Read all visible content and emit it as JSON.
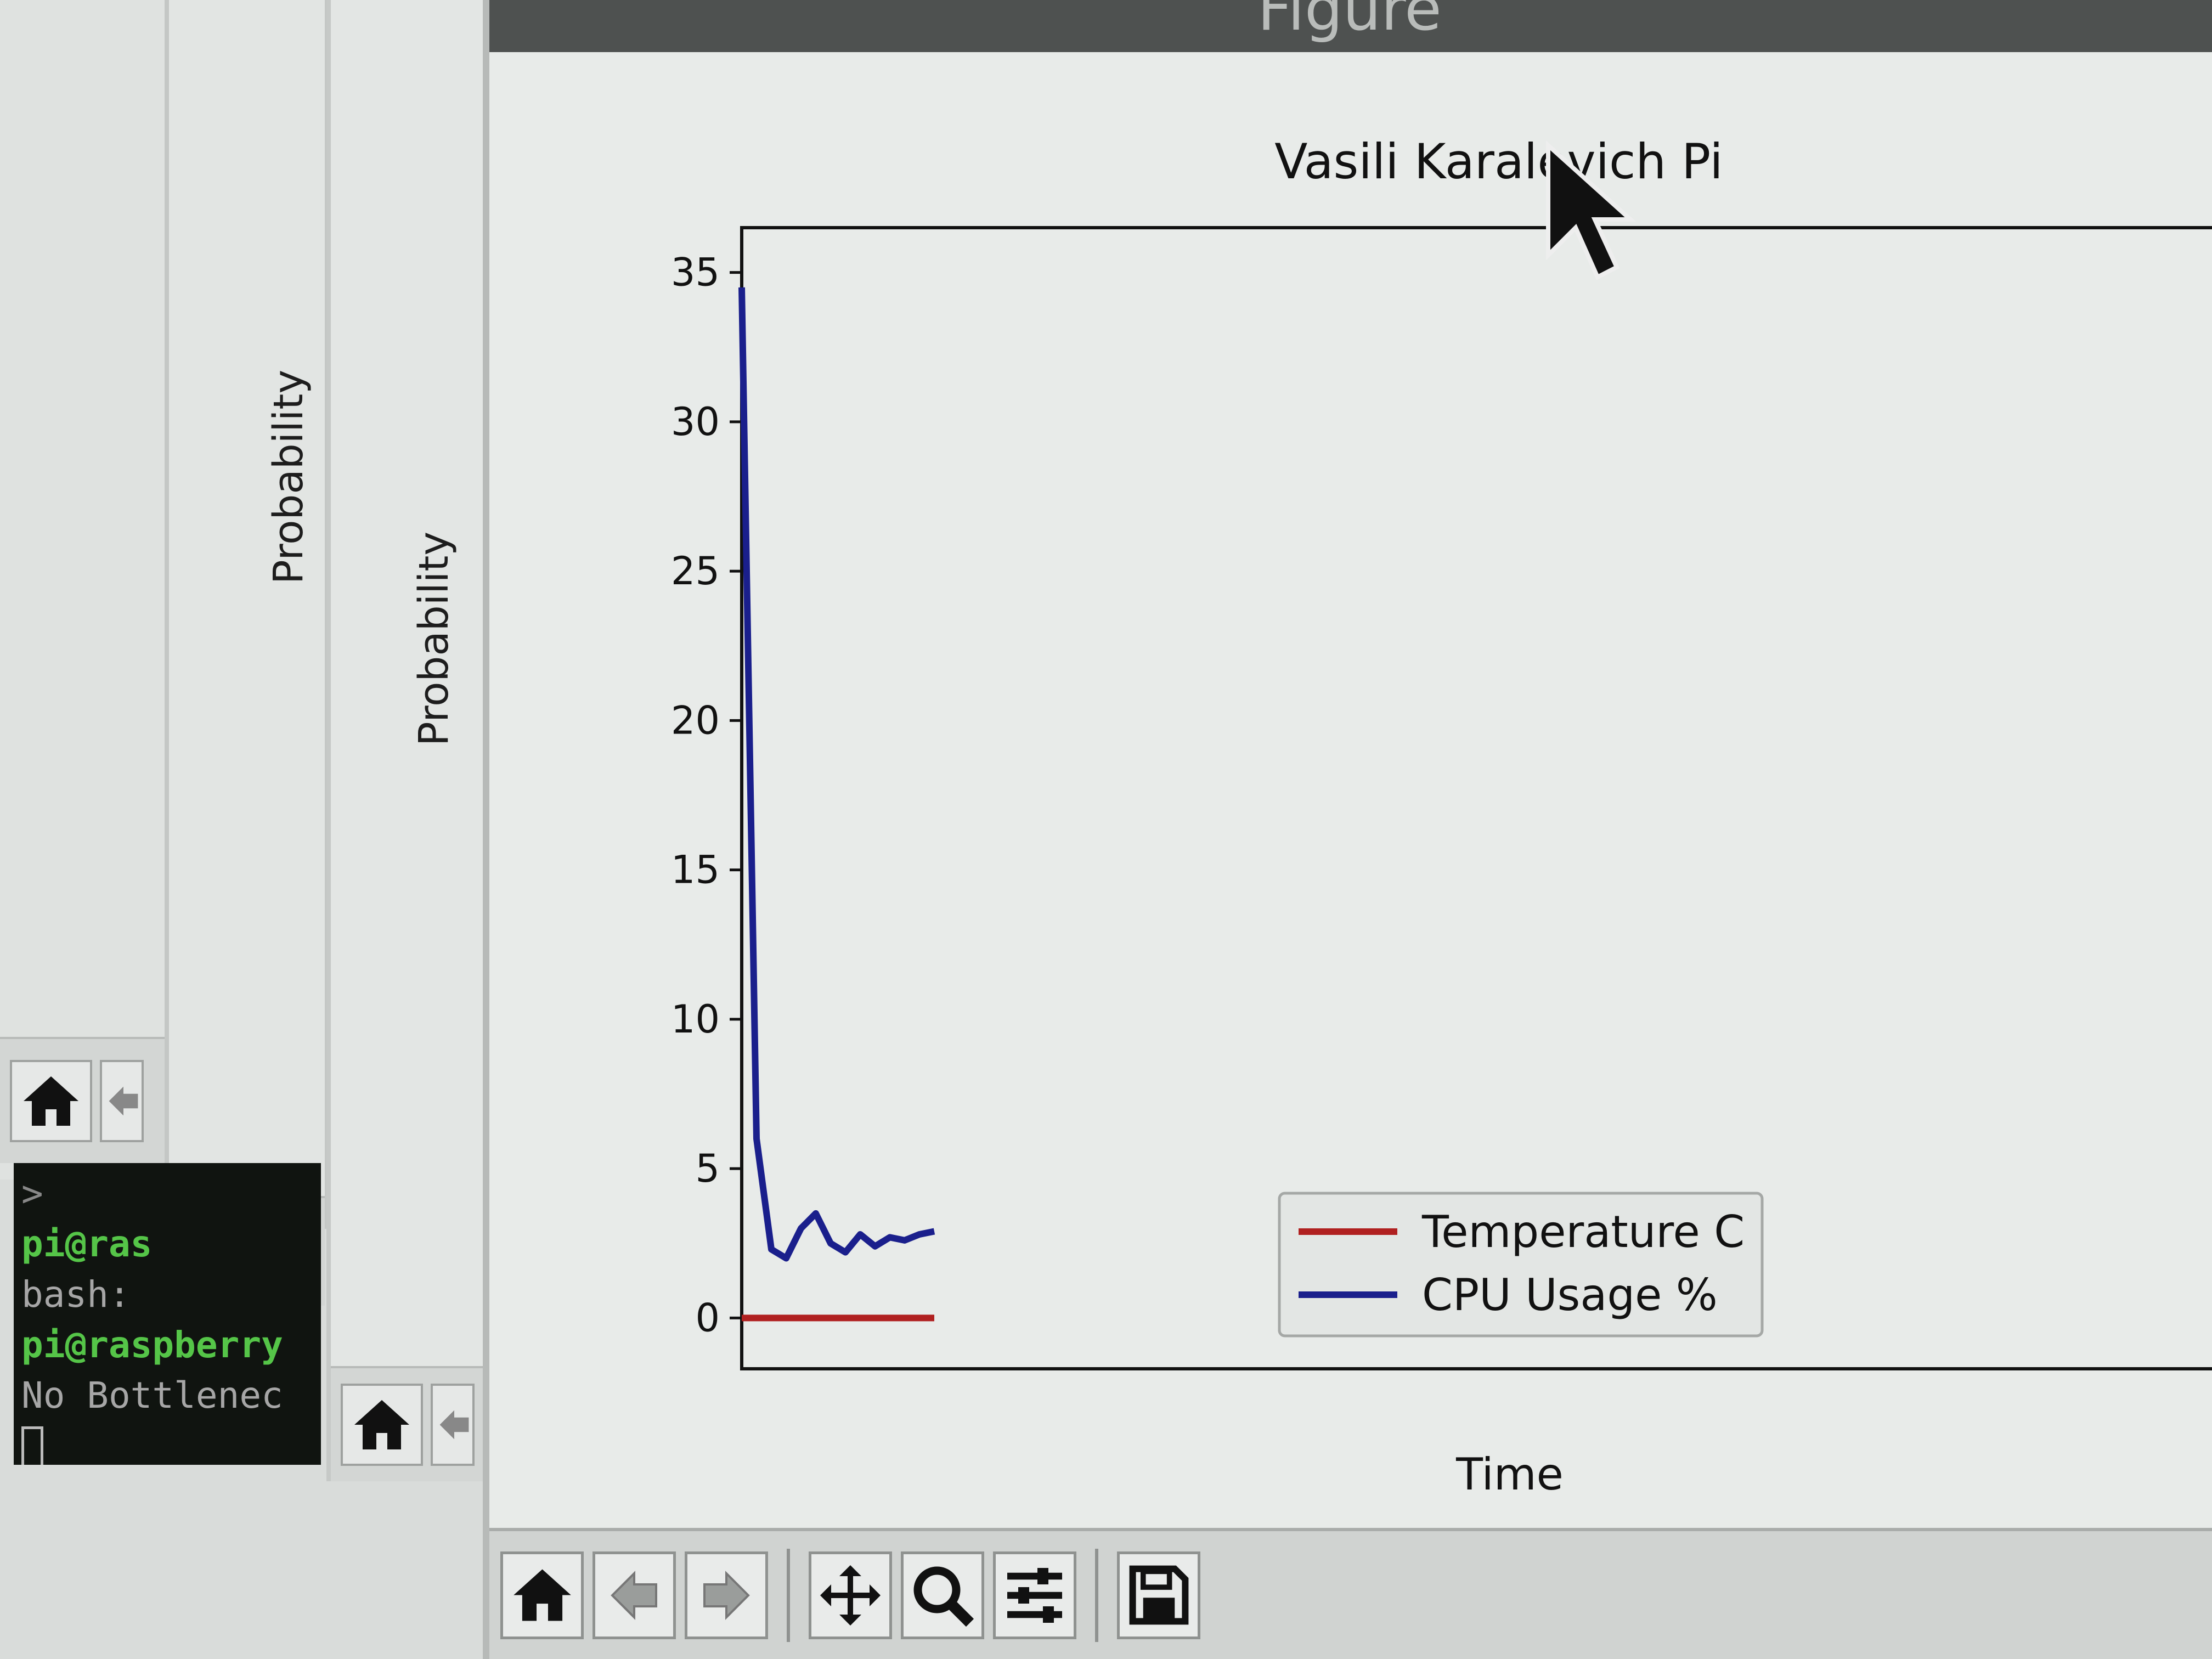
{
  "back_windows": [
    {
      "ylabel": ""
    },
    {
      "ylabel": "Probability"
    },
    {
      "ylabel": "Probability"
    }
  ],
  "terminal": {
    "lines": [
      {
        "text": ">",
        "style": "dim"
      },
      {
        "text": "pi@ras",
        "style": "green"
      },
      {
        "text": "bash: ",
        "style": "dim"
      },
      {
        "text": "pi@raspberry",
        "style": "green"
      },
      {
        "text": "No Bottlenec",
        "style": "dim"
      }
    ]
  },
  "main_window": {
    "title": "Figure"
  },
  "toolbar": {
    "buttons": [
      {
        "name": "home-button",
        "icon": "home-icon"
      },
      {
        "name": "back-button",
        "icon": "arrow-left-icon"
      },
      {
        "name": "forward-button",
        "icon": "arrow-right-icon"
      },
      {
        "name": "pan-button",
        "icon": "move-icon"
      },
      {
        "name": "zoom-button",
        "icon": "magnifier-icon"
      },
      {
        "name": "configure-subplots-button",
        "icon": "sliders-icon"
      },
      {
        "name": "save-button",
        "icon": "floppy-disk-icon"
      }
    ]
  },
  "chart_data": {
    "type": "line",
    "title": "Vasili Karalevich Pi",
    "xlabel": "Time",
    "ylabel": "",
    "ylim": [
      -1.7,
      36.5
    ],
    "xlim": [
      0,
      100
    ],
    "yticks": [
      0,
      5,
      10,
      15,
      20,
      25,
      30,
      35
    ],
    "grid": false,
    "legend_position": "lower-center",
    "series": [
      {
        "name": "Temperature C",
        "color": "#b02020",
        "x": [
          0,
          1,
          2,
          3,
          4,
          5,
          6,
          7,
          8,
          9,
          10,
          11,
          12,
          13
        ],
        "values": [
          0,
          0,
          0,
          0,
          0,
          0,
          0,
          0,
          0,
          0,
          0,
          0,
          0,
          0
        ]
      },
      {
        "name": "CPU Usage %",
        "color": "#1a1f8c",
        "x": [
          0,
          1,
          2,
          3,
          4,
          5,
          6,
          7,
          8,
          9,
          10,
          11,
          12,
          13
        ],
        "values": [
          34.5,
          6,
          2.3,
          2,
          3,
          3.5,
          2.5,
          2.2,
          2.8,
          2.4,
          2.7,
          2.6,
          2.8,
          2.9
        ]
      }
    ]
  }
}
